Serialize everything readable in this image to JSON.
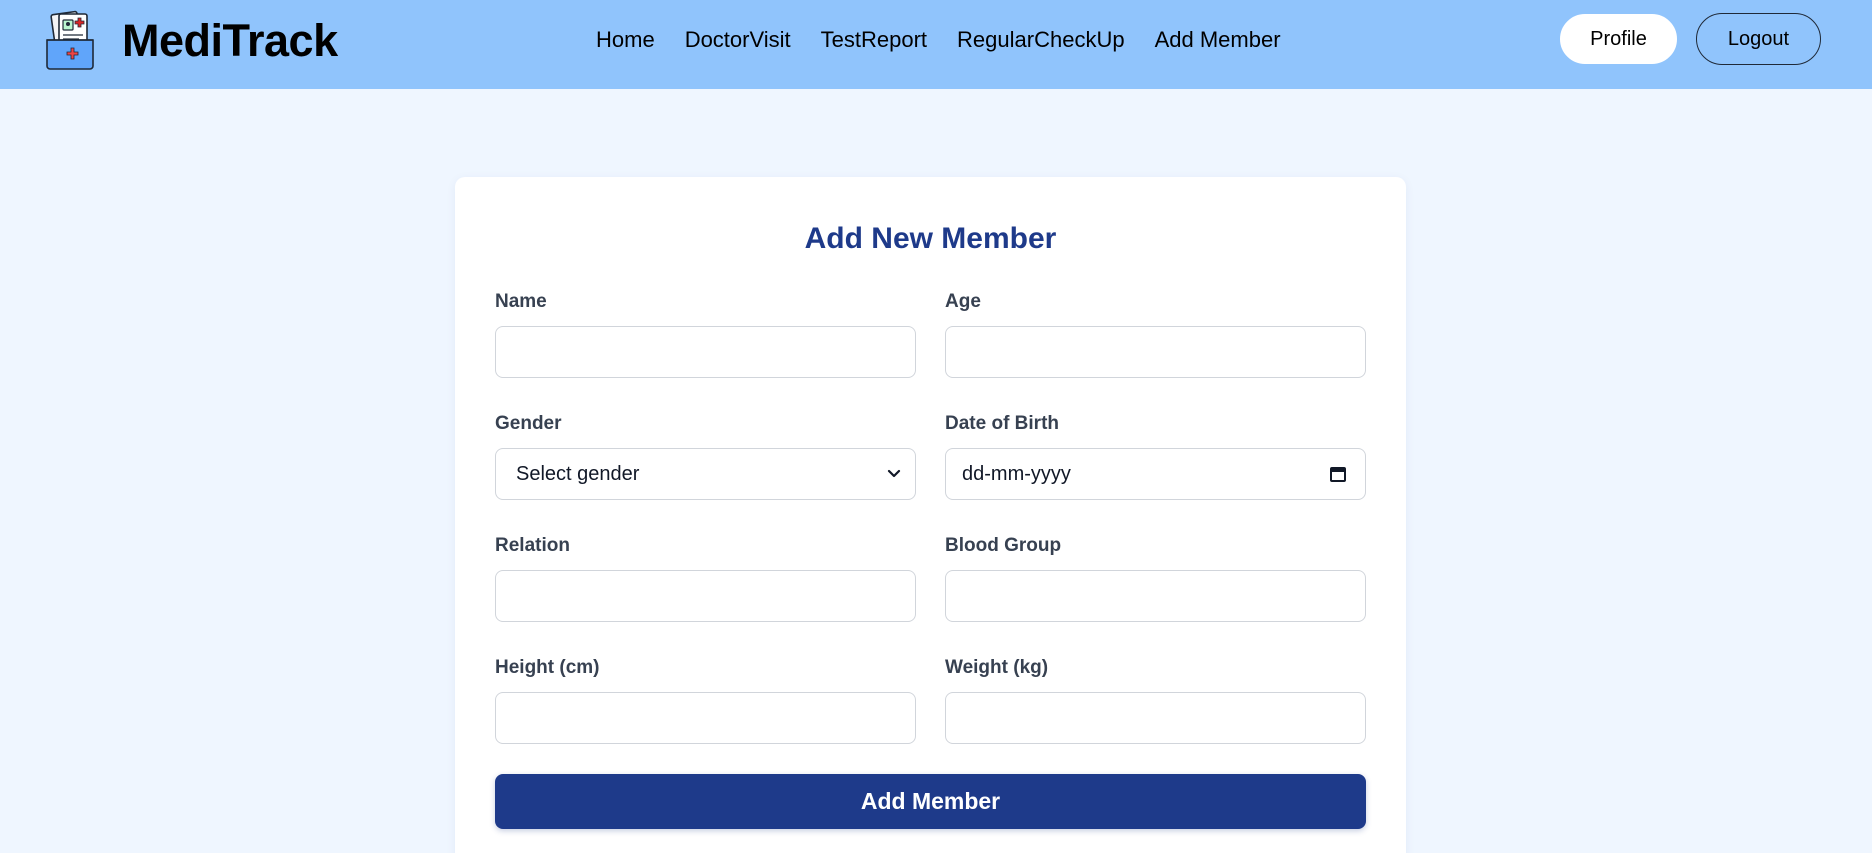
{
  "app": {
    "name": "MediTrack",
    "logo_icon": "medical-folder-icon"
  },
  "nav": {
    "links": [
      "Home",
      "DoctorVisit",
      "TestReport",
      "RegularCheckUp",
      "Add Member"
    ],
    "profile_label": "Profile",
    "logout_label": "Logout"
  },
  "form": {
    "title": "Add New Member",
    "fields": {
      "name": {
        "label": "Name",
        "value": ""
      },
      "age": {
        "label": "Age",
        "value": ""
      },
      "gender": {
        "label": "Gender",
        "selected": "Select gender"
      },
      "dob": {
        "label": "Date of Birth",
        "placeholder": "dd-mm-yyyy"
      },
      "relation": {
        "label": "Relation",
        "value": ""
      },
      "blood_group": {
        "label": "Blood Group",
        "value": ""
      },
      "height": {
        "label": "Height (cm)",
        "value": ""
      },
      "weight": {
        "label": "Weight (kg)",
        "value": ""
      }
    },
    "submit_label": "Add Member"
  },
  "colors": {
    "navbar_bg": "#90c4fc",
    "page_bg": "#eff6ff",
    "accent": "#1e3a8a",
    "title": "#1e3a8a"
  }
}
